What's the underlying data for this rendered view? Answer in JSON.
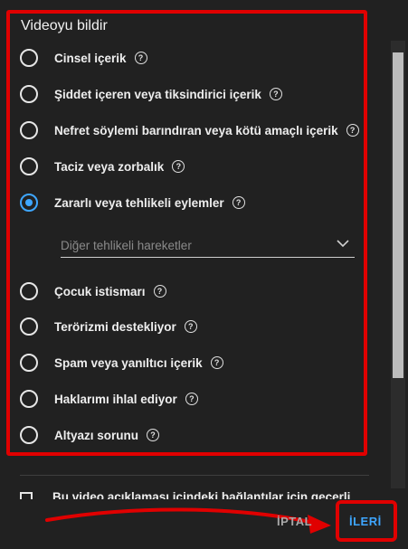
{
  "dialog": {
    "title": "Videoyu bildir",
    "options": [
      {
        "label": "Cinsel içerik",
        "checked": false
      },
      {
        "label": "Şiddet içeren veya tiksindirici içerik",
        "checked": false
      },
      {
        "label": "Nefret söylemi barındıran veya kötü amaçlı içerik",
        "checked": false
      },
      {
        "label": "Taciz veya zorbalık",
        "checked": false
      },
      {
        "label": "Zararlı veya tehlikeli eylemler",
        "checked": true
      },
      {
        "label": "Çocuk istismarı",
        "checked": false
      },
      {
        "label": "Terörizmi destekliyor",
        "checked": false
      },
      {
        "label": "Spam veya yanıltıcı içerik",
        "checked": false
      },
      {
        "label": "Haklarımı ihlal ediyor",
        "checked": false
      },
      {
        "label": "Altyazı sorunu",
        "checked": false
      }
    ],
    "subcategory_dropdown": {
      "placeholder": "Diğer tehlikeli hareketler"
    },
    "help_glyph": "?",
    "extra_checkbox_label": "Bu video açıklaması içindeki bağlantılar için geçerli",
    "cancel_label": "İPTAL",
    "next_label": "İLERİ"
  },
  "colors": {
    "accent": "#3ea6ff",
    "annotation_red": "#e00000",
    "background": "#212121"
  },
  "icons": [
    "radio-icon",
    "help-icon",
    "chevron-down-icon",
    "checkbox-icon",
    "annotation-arrow-icon"
  ]
}
